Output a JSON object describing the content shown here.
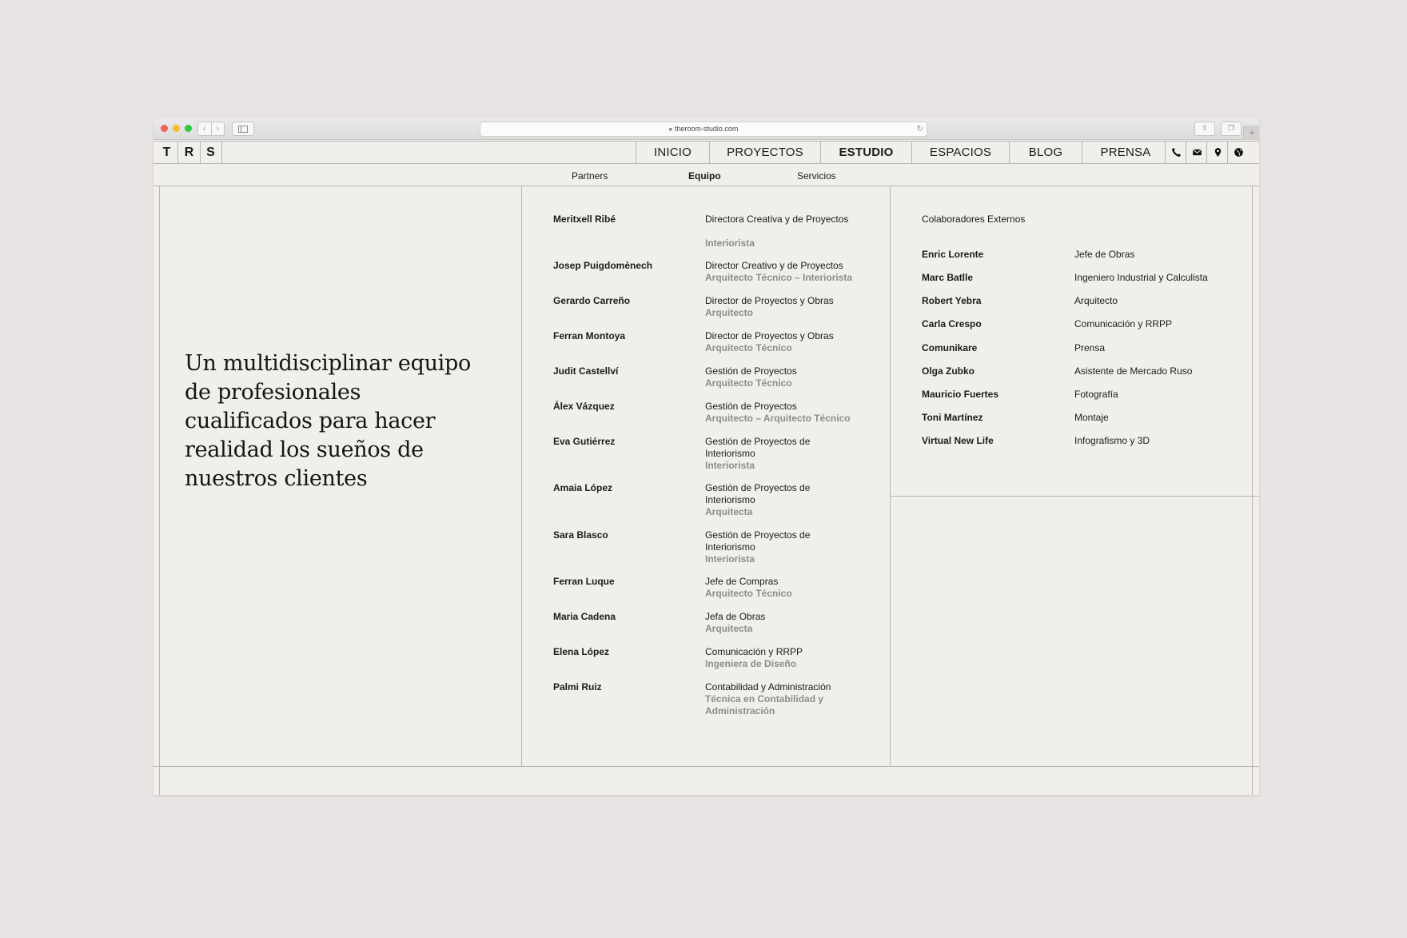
{
  "browser": {
    "url": "theroom-studio.com",
    "lock_icon": "lock-icon",
    "back_icon": "‹",
    "forward_icon": "›",
    "reload_icon": "↻",
    "share_icon": "⇪",
    "tabs_icon": "❐",
    "new_tab_icon": "+"
  },
  "logo": {
    "t": "T",
    "r": "R",
    "s": "S"
  },
  "nav": {
    "items": [
      "INICIO",
      "PROYECTOS",
      "ESTUDIO",
      "ESPACIOS",
      "BLOG",
      "PRENSA"
    ],
    "active": "ESTUDIO",
    "icons": [
      "phone-icon",
      "envelope-icon",
      "map-pin-icon",
      "globe-icon"
    ]
  },
  "subnav": {
    "items": [
      "Partners",
      "Equipo",
      "Servicios"
    ],
    "active": "Equipo"
  },
  "heading": "Un multidisciplinar equipo de profesionales cualificados para hacer realidad los sueños de nuestros clientes",
  "team": [
    {
      "name": "Meritxell Ribé",
      "role": "Directora Creativa y de Proyectos",
      "title": "Interiorista"
    },
    {
      "name": "Josep Puigdomènech",
      "role": "Director Creativo y de Proyectos",
      "title": "Arquitecto Técnico – Interiorista"
    },
    {
      "name": "Gerardo Carreño",
      "role": "Director de Proyectos y Obras",
      "title": "Arquitecto"
    },
    {
      "name": "Ferran Montoya",
      "role": "Director de Proyectos y Obras",
      "title": "Arquitecto Técnico"
    },
    {
      "name": "Judit Castellví",
      "role": "Gestión de Proyectos",
      "title": "Arquitecto Técnico"
    },
    {
      "name": "Álex Vázquez",
      "role": "Gestión de Proyectos",
      "title": "Arquitecto – Arquitecto Técnico"
    },
    {
      "name": "Eva Gutiérrez",
      "role": "Gestión de Proyectos de Interiorismo",
      "title": "Interiorista"
    },
    {
      "name": "Amaia López",
      "role": "Gestión de Proyectos de Interiorismo",
      "title": "Arquitecta"
    },
    {
      "name": "Sara Blasco",
      "role": "Gestión de Proyectos de Interiorismo",
      "title": "Interiorista"
    },
    {
      "name": "Ferran Luque",
      "role": "Jefe de Compras",
      "title": "Arquitecto Técnico"
    },
    {
      "name": "Maria Cadena",
      "role": "Jefa de Obras",
      "title": "Arquitecta"
    },
    {
      "name": "Elena López",
      "role": "Comunicación y RRPP",
      "title": "Ingeniera de Diseño"
    },
    {
      "name": "Palmi Ruiz",
      "role": "Contabilidad y Administración",
      "title": "Técnica en Contabilidad y Administración"
    }
  ],
  "external": {
    "heading": "Colaboradores Externos",
    "items": [
      {
        "name": "Enric Lorente",
        "role": "Jefe de Obras"
      },
      {
        "name": "Marc Batlle",
        "role": "Ingeniero Industrial y Calculista"
      },
      {
        "name": "Robert Yebra",
        "role": "Arquitecto"
      },
      {
        "name": "Carla Crespo",
        "role": "Comunicación y RRPP"
      },
      {
        "name": "Comunikare",
        "role": "Prensa"
      },
      {
        "name": "Olga Zubko",
        "role": "Asistente de Mercado Ruso"
      },
      {
        "name": "Mauricio Fuertes",
        "role": "Fotografía"
      },
      {
        "name": "Toni Martínez",
        "role": "Montaje"
      },
      {
        "name": "Virtual New Life",
        "role": "Infografismo y 3D"
      }
    ]
  },
  "colors": {
    "background": "#e7e4e3",
    "page": "#f0efeb",
    "rule": "#b8b6b2",
    "text": "#1b1b1b",
    "muted": "#8c8c8c"
  }
}
